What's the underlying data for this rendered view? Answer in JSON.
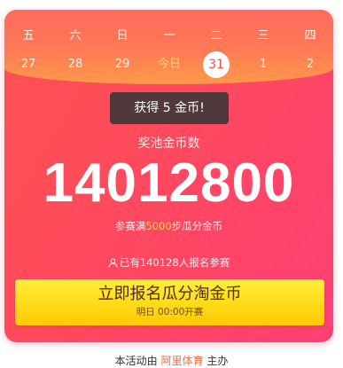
{
  "calendar": {
    "weekdays": [
      "五",
      "六",
      "日",
      "一",
      "二",
      "三",
      "四"
    ],
    "dates": [
      "27",
      "28",
      "29",
      "今日",
      "31",
      "1",
      "2"
    ],
    "selected_index": 4,
    "today_index": 3
  },
  "toast": {
    "text": "获得 5 金币!"
  },
  "pool": {
    "label": "奖池金币数",
    "amount": "14012800"
  },
  "rule": {
    "prefix": "参赛满",
    "steps": "5000",
    "suffix": "步瓜分金币"
  },
  "signup": {
    "text": "已有140128人报名参赛"
  },
  "cta": {
    "title": "立即报名瓜分淘金币",
    "subtitle": "明日 00:00开赛"
  },
  "footer": {
    "prefix": "本活动由",
    "brand": "阿里体育",
    "suffix": "主办"
  },
  "colors": {
    "card": "#ff4a5c",
    "highlight": "#ffd84a",
    "cta": "#ffd816",
    "brand": "#ff6a3c"
  },
  "icons": {
    "signup": "person-icon"
  }
}
